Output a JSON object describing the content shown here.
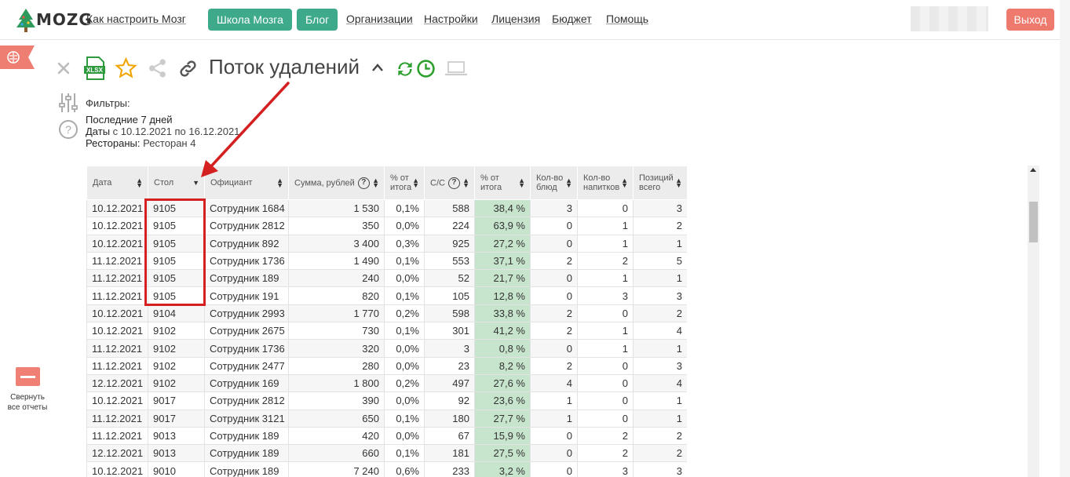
{
  "nav": {
    "logo_text": "MOZG",
    "how_to": "Как настроить Мозг",
    "school": "Школа Мозга",
    "blog": "Блог",
    "orgs": "Организации",
    "settings": "Настройки",
    "license": "Лицензия",
    "budget": "Бюджет",
    "help": "Помощь",
    "logout": "Выход"
  },
  "toolbar": {
    "title": "Поток удалений",
    "xlsx": "XLSX"
  },
  "sidebar": {
    "collapse_label_1": "Свернуть",
    "collapse_label_2": "все отчеты"
  },
  "filters": {
    "label": "Фильтры:",
    "period": "Последние 7 дней",
    "dates_key": "Даты",
    "dates_value": "с 10.12.2021 по 16.12.2021",
    "rest_key": "Рестораны:",
    "rest_value": "Ресторан 4"
  },
  "table": {
    "headers": [
      "Дата",
      "Стол",
      "Официант",
      "Сумма, рублей",
      "% от итога",
      "С/С",
      "% от итога",
      "Кол-во блюд",
      "Кол-во напитков",
      "Позиций всего"
    ],
    "rows": [
      [
        "10.12.2021",
        "9105",
        "Сотрудник 1684",
        "1 530",
        "0,1%",
        "588",
        "38,4 %",
        "3",
        "0",
        "3"
      ],
      [
        "10.12.2021",
        "9105",
        "Сотрудник 2812",
        "350",
        "0,0%",
        "224",
        "63,9 %",
        "0",
        "1",
        "2"
      ],
      [
        "10.12.2021",
        "9105",
        "Сотрудник 892",
        "3 400",
        "0,3%",
        "925",
        "27,2 %",
        "0",
        "1",
        "1"
      ],
      [
        "11.12.2021",
        "9105",
        "Сотрудник 1736",
        "1 490",
        "0,1%",
        "553",
        "37,1 %",
        "2",
        "2",
        "5"
      ],
      [
        "11.12.2021",
        "9105",
        "Сотрудник 189",
        "240",
        "0,0%",
        "52",
        "21,7 %",
        "0",
        "1",
        "1"
      ],
      [
        "11.12.2021",
        "9105",
        "Сотрудник 191",
        "820",
        "0,1%",
        "105",
        "12,8 %",
        "0",
        "3",
        "3"
      ],
      [
        "10.12.2021",
        "9104",
        "Сотрудник 2993",
        "1 770",
        "0,2%",
        "598",
        "33,8 %",
        "2",
        "0",
        "2"
      ],
      [
        "10.12.2021",
        "9102",
        "Сотрудник 2675",
        "730",
        "0,1%",
        "301",
        "41,2 %",
        "2",
        "1",
        "4"
      ],
      [
        "11.12.2021",
        "9102",
        "Сотрудник 1736",
        "320",
        "0,0%",
        "3",
        "0,8 %",
        "0",
        "1",
        "1"
      ],
      [
        "11.12.2021",
        "9102",
        "Сотрудник 2477",
        "280",
        "0,0%",
        "23",
        "8,2 %",
        "2",
        "0",
        "3"
      ],
      [
        "12.12.2021",
        "9102",
        "Сотрудник 169",
        "1 800",
        "0,2%",
        "497",
        "27,6 %",
        "4",
        "0",
        "4"
      ],
      [
        "10.12.2021",
        "9017",
        "Сотрудник 2812",
        "390",
        "0,0%",
        "92",
        "23,6 %",
        "1",
        "0",
        "1"
      ],
      [
        "11.12.2021",
        "9017",
        "Сотрудник 3121",
        "650",
        "0,1%",
        "180",
        "27,7 %",
        "1",
        "0",
        "1"
      ],
      [
        "11.12.2021",
        "9013",
        "Сотрудник 189",
        "420",
        "0,0%",
        "67",
        "15,9 %",
        "0",
        "2",
        "2"
      ],
      [
        "12.12.2021",
        "9013",
        "Сотрудник 189",
        "660",
        "0,1%",
        "181",
        "27,5 %",
        "0",
        "2",
        "2"
      ],
      [
        "10.12.2021",
        "9010",
        "Сотрудник 189",
        "7 240",
        "0,6%",
        "233",
        "3,2 %",
        "0",
        "3",
        "3"
      ]
    ]
  }
}
